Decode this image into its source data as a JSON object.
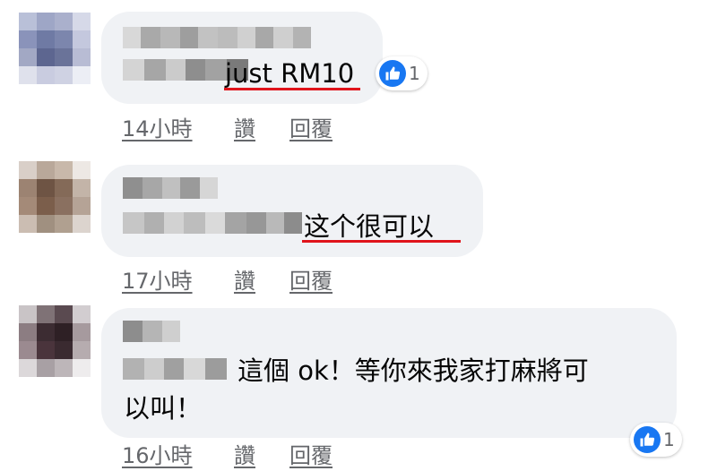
{
  "colors": {
    "bubble": "#f0f2f5",
    "meta_text": "#65676b",
    "underline": "#e0141b",
    "like_blue": "#1877f2"
  },
  "comments": [
    {
      "text": "just RM10",
      "time": "14小時",
      "like_label": "讚",
      "reply_label": "回覆",
      "reaction_icon": "thumbs-up-icon",
      "reaction_count": "1"
    },
    {
      "text": "这个很可以",
      "time": "17小時",
      "like_label": "讚",
      "reply_label": "回覆"
    },
    {
      "text_line1": "這個 ok！等你來我家打麻將可",
      "text_line2": "以叫！",
      "time": "16小時",
      "like_label": "讚",
      "reply_label": "回覆",
      "reaction_icon": "thumbs-up-icon",
      "reaction_count": "1"
    }
  ]
}
